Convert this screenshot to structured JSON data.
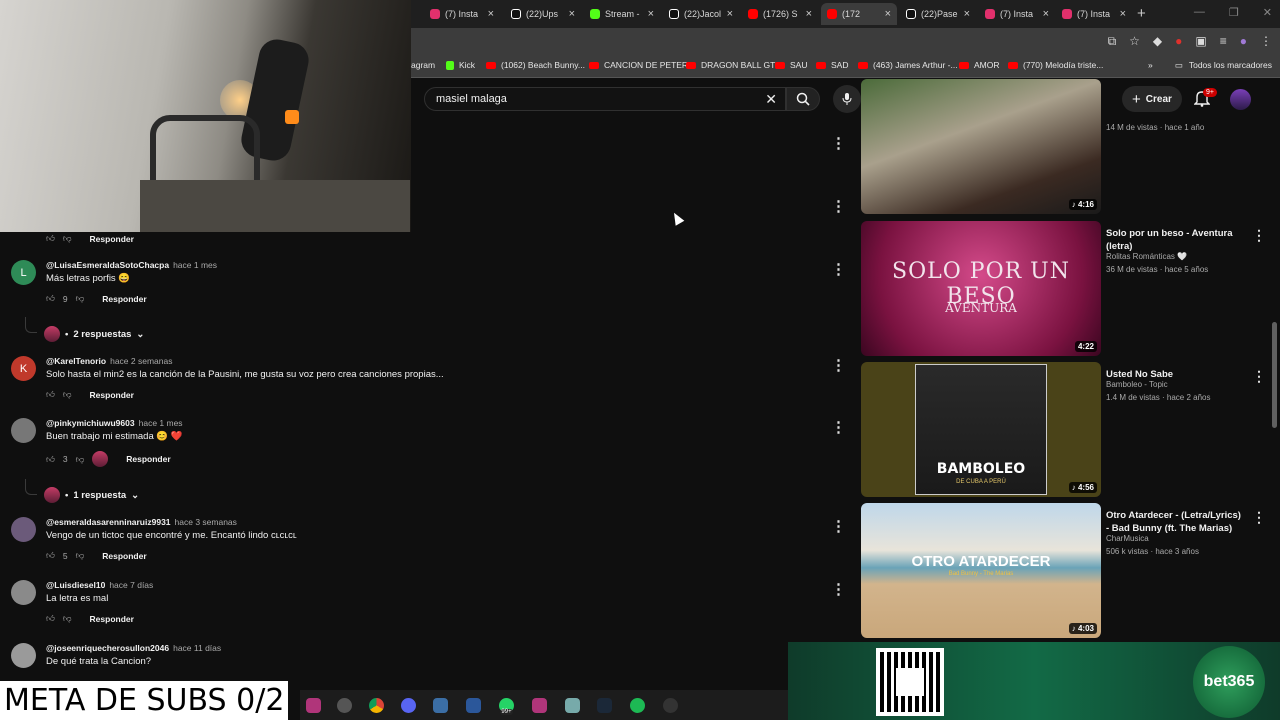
{
  "browser": {
    "tabs": [
      {
        "label": "(7) Insta",
        "icon": "instagram-icon",
        "color": "#e1306c"
      },
      {
        "label": "(22)Ups",
        "icon": "tiktok-icon",
        "color": "#ffffff"
      },
      {
        "label": "Stream -",
        "icon": "kick-icon",
        "color": "#53fc18"
      },
      {
        "label": "(22)Jacol",
        "icon": "tiktok-icon",
        "color": "#ffffff"
      },
      {
        "label": "(1726) S",
        "icon": "youtube-icon",
        "color": "#ff0000"
      },
      {
        "label": "(172",
        "icon": "youtube-icon",
        "color": "#ff0000",
        "active": true
      },
      {
        "label": "(22)Pase",
        "icon": "tiktok-icon",
        "color": "#ffffff"
      },
      {
        "label": "(7) Insta",
        "icon": "instagram-icon",
        "color": "#e1306c"
      },
      {
        "label": "(7) Insta",
        "icon": "instagram-icon",
        "color": "#e1306c"
      }
    ],
    "bookmarks": [
      {
        "label": "agram",
        "icon": "instagram-icon"
      },
      {
        "label": "Kick",
        "icon": "kick-icon"
      },
      {
        "label": "(1062) Beach Bunny...",
        "icon": "youtube-icon"
      },
      {
        "label": "CANCION DE PETER",
        "icon": "youtube-icon"
      },
      {
        "label": "DRAGON BALL GT",
        "icon": "youtube-icon"
      },
      {
        "label": "SAU",
        "icon": "youtube-icon"
      },
      {
        "label": "SAD",
        "icon": "youtube-icon"
      },
      {
        "label": "(463) James Arthur -...",
        "icon": "youtube-icon"
      },
      {
        "label": "AMOR",
        "icon": "youtube-icon"
      },
      {
        "label": "(770) Melodía triste...",
        "icon": "youtube-icon"
      }
    ],
    "bookmarks_folder": "Todos los marcadores"
  },
  "youtube": {
    "search_value": "masiel malaga",
    "create_label": "Crear",
    "notification_count": "9+"
  },
  "comments": [
    {
      "author": "@LuisaEsmeraldaSotoChacpa",
      "when": "hace 1 mes",
      "text": "Más letras porfis 😄",
      "likes": "9",
      "avatar_letter": "L",
      "avatar_color": "#2e8b57",
      "replies": "2 respuestas"
    },
    {
      "author": "@KarelTenorio",
      "when": "hace 2 semanas",
      "text": "Solo hasta el min2 es la canción de la Pausini, me gusta su voz pero crea canciones propias...",
      "likes": "",
      "avatar_letter": "K",
      "avatar_color": "#c0392b"
    },
    {
      "author": "@pinkymichiuwu9603",
      "when": "hace 1 mes",
      "text": "Buen trabajo mi estimada 😊 ❤️",
      "likes": "3",
      "avatar_letter": "",
      "avatar_color": "#777777",
      "replies": "1 respuesta"
    },
    {
      "author": "@esmeraldasarenninaruiz9931",
      "when": "hace 3 semanas",
      "text": "Vengo de un tictoc que encontré y me. Encantó lindo ᴄʟᴄʟᴄʟ",
      "likes": "5",
      "avatar_letter": "",
      "avatar_color": "#6b5a7a"
    },
    {
      "author": "@Luisdiesel10",
      "when": "hace 7 días",
      "text": "La letra es mal",
      "likes": "",
      "avatar_letter": "",
      "avatar_color": "#8a8a8a"
    },
    {
      "author": "@joseenriquecherosullon2046",
      "when": "hace 11 días",
      "text": "De qué trata la Cancion?",
      "likes": "",
      "avatar_letter": "",
      "avatar_color": "#9a9a9a"
    }
  ],
  "reply_label": "Responder",
  "videos": [
    {
      "title": "",
      "channel": "",
      "meta": "14 M de vistas · hace 1 año",
      "duration": "4:16"
    },
    {
      "title": "Solo por un beso - Aventura (letra)",
      "channel": "Rolitas Románticas 🤍",
      "meta": "36 M de vistas · hace 5 años",
      "duration": "4:22",
      "thumb_text1": "SOLO POR UN BESO",
      "thumb_text2": "AVENTURA"
    },
    {
      "title": "Usted No Sabe",
      "channel": "Bamboleo - Topic",
      "meta": "1.4 M de vistas · hace 2 años",
      "duration": "4:56",
      "thumb_text1": "BAMBOLEO",
      "thumb_text2": "DE CUBA A PERÚ"
    },
    {
      "title": "Otro Atardecer - (Letra/Lyrics) - Bad Bunny (ft. The Marias)",
      "channel": "CharMusica",
      "meta": "506 k vistas · hace 3 años",
      "duration": "4:03",
      "thumb_text1": "OTRO ATARDECER",
      "thumb_text2": "Bad Bunny - The Marias"
    }
  ],
  "stream": {
    "goal_text": "META DE SUBS 0/2",
    "ad_brand": "bet365",
    "taskbar_badge": "99+"
  }
}
